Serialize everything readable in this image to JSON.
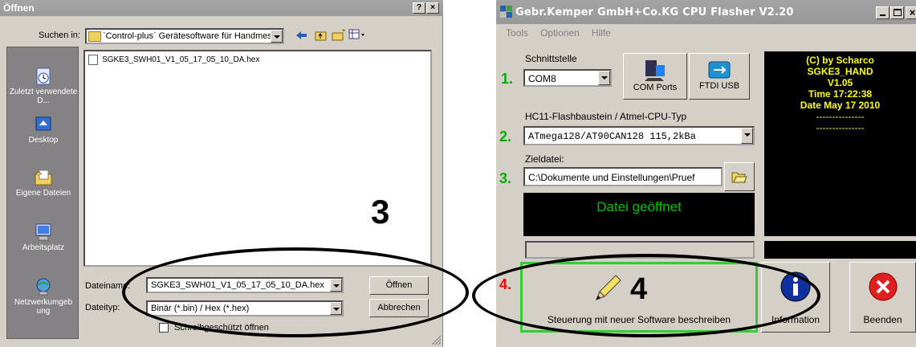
{
  "open_dialog": {
    "title": "Öffnen",
    "title_buttons": [
      "?",
      "×"
    ],
    "lookin_label": "Suchen in:",
    "lookin_value": "`Control-plus` Gerätesoftware für Handmessge",
    "places": [
      {
        "label": "Zuletzt verwendete D...",
        "icon": "recent-icon"
      },
      {
        "label": "Desktop",
        "icon": "desktop-icon"
      },
      {
        "label": "Eigene Dateien",
        "icon": "my-documents-icon"
      },
      {
        "label": "Arbeitsplatz",
        "icon": "my-computer-icon"
      },
      {
        "label": "Netzwerkumgeb ung",
        "icon": "network-icon"
      }
    ],
    "files": [
      "SGKE3_SWH01_V1_05_17_05_10_DA.hex"
    ],
    "filename_label": "Dateiname:",
    "filename_value": "SGKE3_SWH01_V1_05_17_05_10_DA.hex",
    "filetype_label": "Dateityp:",
    "filetype_value": "Binär (*.bin) / Hex (*.hex)",
    "readonly_label": "Schreibgeschützt öffnen",
    "open_button": "Öffnen",
    "cancel_button": "Abbrechen",
    "annotation_number": "3"
  },
  "flasher": {
    "title": "Gebr.Kemper GmbH+Co.KG CPU Flasher V2.20",
    "menu": [
      "Tools",
      "Optionen",
      "Hilfe"
    ],
    "interface_label": "Schnittstelle",
    "interface_value": "COM8",
    "com_ports_button": "COM Ports",
    "ftdi_button": "FTDI USB",
    "cpu_label": "HC11-Flashbaustein / Atmel-CPU-Typ",
    "cpu_value": "ATmega128/AT90CAN128 115,2kBa",
    "target_label": "Zieldatei:",
    "target_value": "C:\\Dokumente und Einstellungen\\Pruef",
    "status_text": "Datei geöffnet",
    "steps": [
      "1.",
      "2.",
      "3.",
      "4."
    ],
    "info_lines": [
      "(C) by Scharco",
      "SGKE3_HAND",
      "V1.05",
      "Time 17:22:38",
      "Date May 17 2010",
      "---------------",
      "---------------"
    ],
    "write_button": "Steuerung mit neuer Software beschreiben",
    "information_button": "Information",
    "exit_button": "Beenden",
    "annotation_number": "4",
    "colors": {
      "step_green": "#00b000",
      "step_red": "#ff0000",
      "status_green": "#00c000",
      "info_yellow": "#ffff00",
      "highlight_green": "#33cc33"
    }
  }
}
